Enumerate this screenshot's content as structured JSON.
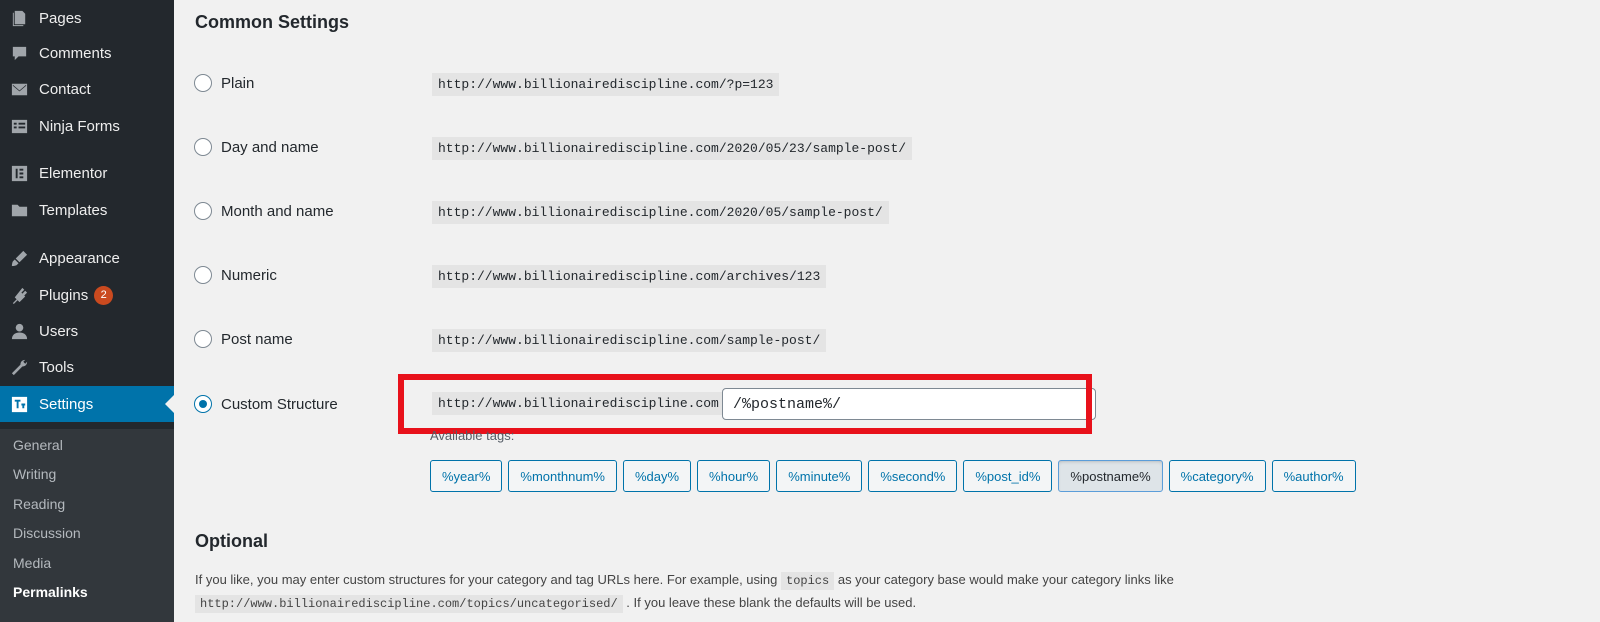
{
  "sidebar": {
    "items": [
      {
        "label": "Pages",
        "icon": "pages-icon"
      },
      {
        "label": "Comments",
        "icon": "comments-icon"
      },
      {
        "label": "Contact",
        "icon": "mail-icon"
      },
      {
        "label": "Ninja Forms",
        "icon": "forms-icon"
      },
      {
        "label": "Elementor",
        "icon": "elementor-icon"
      },
      {
        "label": "Templates",
        "icon": "folder-icon"
      },
      {
        "label": "Appearance",
        "icon": "brush-icon"
      },
      {
        "label": "Plugins",
        "icon": "plug-icon",
        "badge": "2"
      },
      {
        "label": "Users",
        "icon": "user-icon"
      },
      {
        "label": "Tools",
        "icon": "wrench-icon"
      },
      {
        "label": "Settings",
        "icon": "settings-icon",
        "active": true
      }
    ],
    "submenu": [
      "General",
      "Writing",
      "Reading",
      "Discussion",
      "Media",
      "Permalinks"
    ],
    "current_submenu": "Permalinks"
  },
  "main": {
    "common_heading": "Common Settings",
    "options": [
      {
        "label": "Plain",
        "url": "http://www.billionairediscipline.com/?p=123",
        "checked": false
      },
      {
        "label": "Day and name",
        "url": "http://www.billionairediscipline.com/2020/05/23/sample-post/",
        "checked": false
      },
      {
        "label": "Month and name",
        "url": "http://www.billionairediscipline.com/2020/05/sample-post/",
        "checked": false
      },
      {
        "label": "Numeric",
        "url": "http://www.billionairediscipline.com/archives/123",
        "checked": false
      },
      {
        "label": "Post name",
        "url": "http://www.billionairediscipline.com/sample-post/",
        "checked": false
      },
      {
        "label": "Custom Structure",
        "url": "http://www.billionairediscipline.com",
        "checked": true
      }
    ],
    "custom_structure_value": "/%postname%/",
    "available_tags_label": "Available tags:",
    "tags": [
      "%year%",
      "%monthnum%",
      "%day%",
      "%hour%",
      "%minute%",
      "%second%",
      "%post_id%",
      "%postname%",
      "%category%",
      "%author%"
    ],
    "active_tag": "%postname%",
    "optional_heading": "Optional",
    "optional_text_1a": "If you like, you may enter custom structures for your category and tag URLs here. For example, using",
    "optional_code_1": "topics",
    "optional_text_1b": "as your category base would make your category links like",
    "optional_code_2": "http://www.billionairediscipline.com/topics/uncategorised/",
    "optional_text_2": ". If you leave these blank the defaults will be used."
  },
  "colors": {
    "sidebar_bg": "#23282d",
    "active_blue": "#0073aa",
    "highlight_red": "#e8111b",
    "badge_orange": "#ca4a1f"
  }
}
